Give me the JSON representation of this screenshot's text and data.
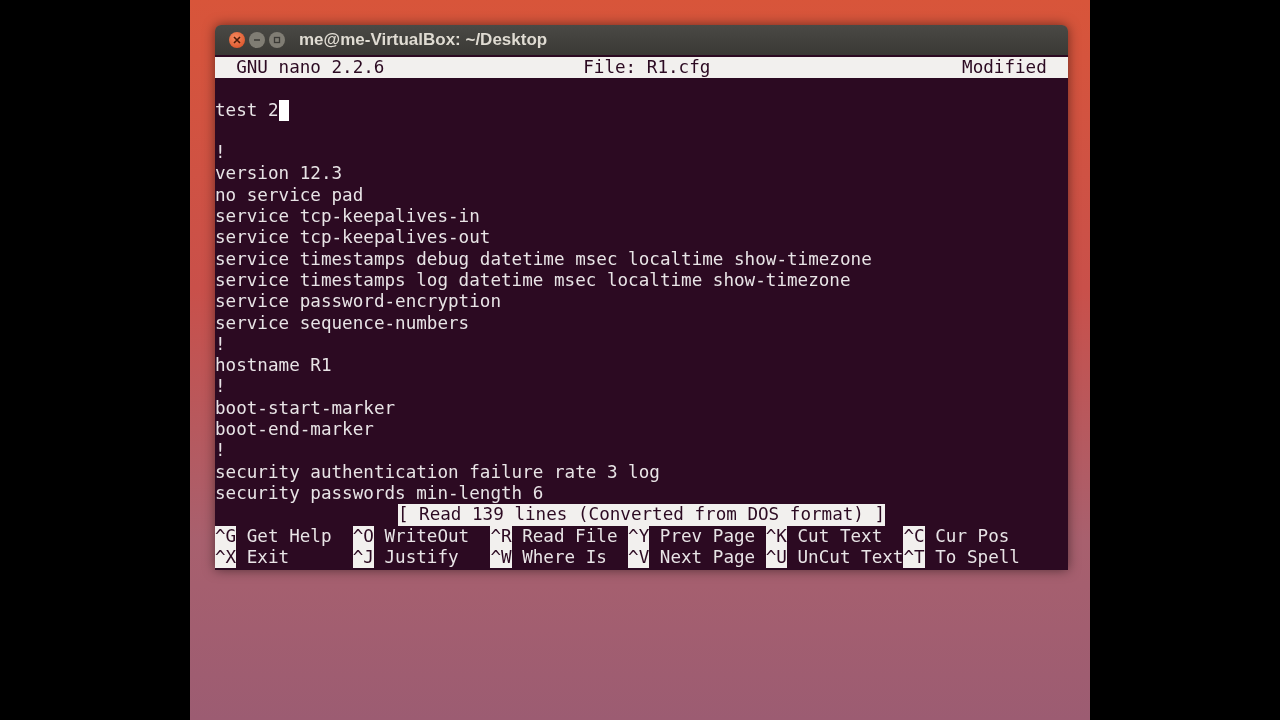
{
  "window": {
    "title": "me@me-VirtualBox: ~/Desktop"
  },
  "nano_header": {
    "version": "GNU nano 2.2.6",
    "file": "File: R1.cfg",
    "state": "Modified"
  },
  "lines": [
    {
      "kind": "blank"
    },
    {
      "kind": "text",
      "text": "test 2",
      "cursor": true
    },
    {
      "kind": "blank"
    },
    {
      "kind": "text",
      "text": "!",
      "cursor": false
    },
    {
      "kind": "text",
      "text": "version 12.3",
      "cursor": false
    },
    {
      "kind": "text",
      "text": "no service pad",
      "cursor": false
    },
    {
      "kind": "text",
      "text": "service tcp-keepalives-in",
      "cursor": false
    },
    {
      "kind": "text",
      "text": "service tcp-keepalives-out",
      "cursor": false
    },
    {
      "kind": "text",
      "text": "service timestamps debug datetime msec localtime show-timezone",
      "cursor": false
    },
    {
      "kind": "text",
      "text": "service timestamps log datetime msec localtime show-timezone",
      "cursor": false
    },
    {
      "kind": "text",
      "text": "service password-encryption",
      "cursor": false
    },
    {
      "kind": "text",
      "text": "service sequence-numbers",
      "cursor": false
    },
    {
      "kind": "text",
      "text": "!",
      "cursor": false
    },
    {
      "kind": "text",
      "text": "hostname R1",
      "cursor": false
    },
    {
      "kind": "text",
      "text": "!",
      "cursor": false
    },
    {
      "kind": "text",
      "text": "boot-start-marker",
      "cursor": false
    },
    {
      "kind": "text",
      "text": "boot-end-marker",
      "cursor": false
    },
    {
      "kind": "text",
      "text": "!",
      "cursor": false
    },
    {
      "kind": "text",
      "text": "security authentication failure rate 3 log",
      "cursor": false
    },
    {
      "kind": "text",
      "text": "security passwords min-length 6",
      "cursor": false
    }
  ],
  "status_message": "[ Read 139 lines (Converted from DOS format) ]",
  "shortcuts": [
    [
      {
        "key": "^G",
        "label": "Get Help"
      },
      {
        "key": "^O",
        "label": "WriteOut"
      },
      {
        "key": "^R",
        "label": "Read File"
      },
      {
        "key": "^Y",
        "label": "Prev Page"
      },
      {
        "key": "^K",
        "label": "Cut Text"
      },
      {
        "key": "^C",
        "label": "Cur Pos"
      }
    ],
    [
      {
        "key": "^X",
        "label": "Exit"
      },
      {
        "key": "^J",
        "label": "Justify"
      },
      {
        "key": "^W",
        "label": "Where Is"
      },
      {
        "key": "^V",
        "label": "Next Page"
      },
      {
        "key": "^U",
        "label": "UnCut Text"
      },
      {
        "key": "^T",
        "label": "To Spell"
      }
    ]
  ]
}
